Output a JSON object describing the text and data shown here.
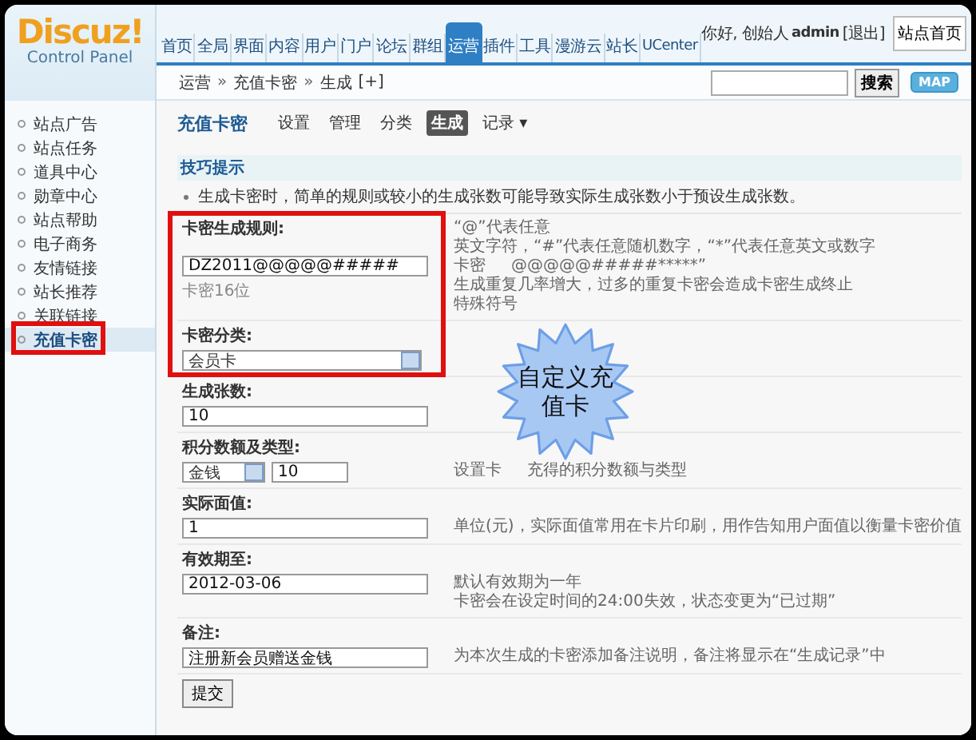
{
  "logo": {
    "title": "Discuz!",
    "subtitle": "Control Panel"
  },
  "nav": [
    {
      "label": "首页",
      "selected": false
    },
    {
      "label": "全局",
      "selected": false
    },
    {
      "label": "界面",
      "selected": false
    },
    {
      "label": "内容",
      "selected": false
    },
    {
      "label": "用户",
      "selected": false
    },
    {
      "label": "门户",
      "selected": false
    },
    {
      "label": "论坛",
      "selected": false
    },
    {
      "label": "群组",
      "selected": false
    },
    {
      "label": "运营",
      "selected": true
    },
    {
      "label": "插件",
      "selected": false
    },
    {
      "label": "工具",
      "selected": false
    },
    {
      "label": "漫游云",
      "selected": false
    },
    {
      "label": "站长",
      "selected": false
    },
    {
      "label": "UCenter",
      "selected": false
    }
  ],
  "user": {
    "greeting": "你好, 创始人",
    "name": "admin",
    "logout": "[退出]"
  },
  "home_button": "站点首页",
  "breadcrumb": {
    "items": [
      "运营",
      "充值卡密",
      "生成"
    ],
    "separator": "»",
    "add": "[+]"
  },
  "search": {
    "button": "搜索"
  },
  "map_button": "MAP",
  "sidebar": [
    {
      "label": "站点广告",
      "selected": false
    },
    {
      "label": "站点任务",
      "selected": false
    },
    {
      "label": "道具中心",
      "selected": false
    },
    {
      "label": "勋章中心",
      "selected": false
    },
    {
      "label": "站点帮助",
      "selected": false
    },
    {
      "label": "电子商务",
      "selected": false
    },
    {
      "label": "友情链接",
      "selected": false
    },
    {
      "label": "站长推荐",
      "selected": false
    },
    {
      "label": "关联链接",
      "selected": false
    },
    {
      "label": "充值卡密",
      "selected": true
    }
  ],
  "page": {
    "title": "充值卡密",
    "tabs": [
      {
        "label": "设置",
        "selected": false
      },
      {
        "label": "管理",
        "selected": false
      },
      {
        "label": "分类",
        "selected": false
      },
      {
        "label": "生成",
        "selected": true
      },
      {
        "label": "记录",
        "selected": false,
        "menu": "▾"
      }
    ]
  },
  "tips": {
    "title": "技巧提示",
    "items": [
      "生成卡密时，简单的规则或较小的生成张数可能导致实际生成张数小于预设生成张数。"
    ]
  },
  "form": [
    {
      "label": "卡密生成规则:",
      "kind": "input",
      "value": "DZ2011@@@@@#####",
      "note": "卡密16位",
      "hints": [
        {
          "before": "“@”代表任意",
          "after": "英文字符，“#”代表任意随机数字，“*”代表任意英文或数字"
        },
        {
          "before": "卡密",
          "after": "@@@@@#####*****”"
        },
        {
          "after": "生成重复几率增大，过多的重复卡密会造成卡密生成终止"
        },
        {
          "after": "特殊符号"
        }
      ]
    },
    {
      "label": "卡密分类:",
      "kind": "select",
      "value": "会员卡"
    },
    {
      "label": "生成张数:",
      "kind": "input",
      "value": "10"
    },
    {
      "label": "积分数额及类型:",
      "kind": "select_input",
      "value": "金钱",
      "amount": "10",
      "hints": [
        {
          "before": "设置卡",
          "after": "充得的积分数额与类型"
        }
      ]
    },
    {
      "label": "实际面值:",
      "kind": "input",
      "value": "1",
      "hints": [
        {
          "before": "单位(元)，实际面值常用在卡片印刷，用作告知用户面值以衡量卡密价值"
        }
      ]
    },
    {
      "label": "有效期至:",
      "kind": "input",
      "value": "2012-03-06",
      "hints": [
        {
          "before": "默认有效期为一年"
        },
        {
          "before": "卡密会在设定时间的24:00失效，状态变更为“已过期”"
        }
      ]
    },
    {
      "label": "备注:",
      "kind": "input",
      "value": "注册新会员赠送金钱",
      "hints": [
        {
          "before": "为本次生成的卡密添加备注说明，备注将显示在“生成记录”中"
        }
      ]
    }
  ],
  "submit": "提交",
  "callout": {
    "text": "自定义充值卡"
  }
}
